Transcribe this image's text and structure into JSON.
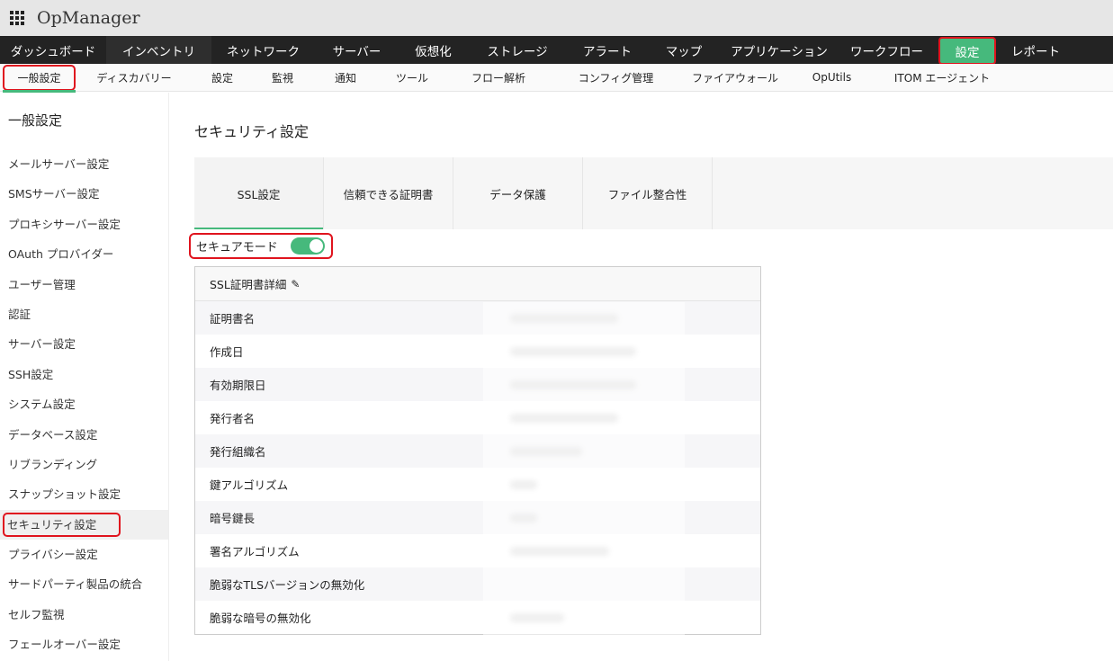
{
  "app": {
    "title": "OpManager"
  },
  "nav": [
    "ダッシュボード",
    "インベントリ",
    "ネットワーク",
    "サーバー",
    "仮想化",
    "ストレージ",
    "アラート",
    "マップ",
    "アプリケーション",
    "ワークフロー",
    "設定",
    "レポート"
  ],
  "subnav": [
    "一般設定",
    "ディスカバリー",
    "設定",
    "監視",
    "通知",
    "ツール",
    "フロー解析",
    "コンフィグ管理",
    "ファイアウォール",
    "OpUtils",
    "ITOM エージェント"
  ],
  "sidebar": {
    "title": "一般設定",
    "items": [
      "メールサーバー設定",
      "SMSサーバー設定",
      "プロキシサーバー設定",
      "OAuth プロバイダー",
      "ユーザー管理",
      "認証",
      "サーバー設定",
      "SSH設定",
      "システム設定",
      "データベース設定",
      "リブランディング",
      "スナップショット設定",
      "セキュリティ設定",
      "プライバシー設定",
      "サードパーティ製品の統合",
      "セルフ監視",
      "フェールオーバー設定"
    ]
  },
  "main": {
    "title": "セキュリティ設定",
    "tabs": [
      "SSL設定",
      "信頼できる証明書",
      "データ保護",
      "ファイル整合性"
    ],
    "secure_mode_label": "セキュアモード",
    "secure_mode_on": true,
    "card": {
      "title": "SSL証明書詳細",
      "rows": [
        "証明書名",
        "作成日",
        "有効期限日",
        "発行者名",
        "発行組織名",
        "鍵アルゴリズム",
        "暗号鍵長",
        "署名アルゴリズム",
        "脆弱なTLSバージョンの無効化",
        "脆弱な暗号の無効化"
      ]
    }
  },
  "colors": {
    "accent": "#46b97c",
    "highlight": "#e0141e",
    "nav_bg": "#232323"
  }
}
